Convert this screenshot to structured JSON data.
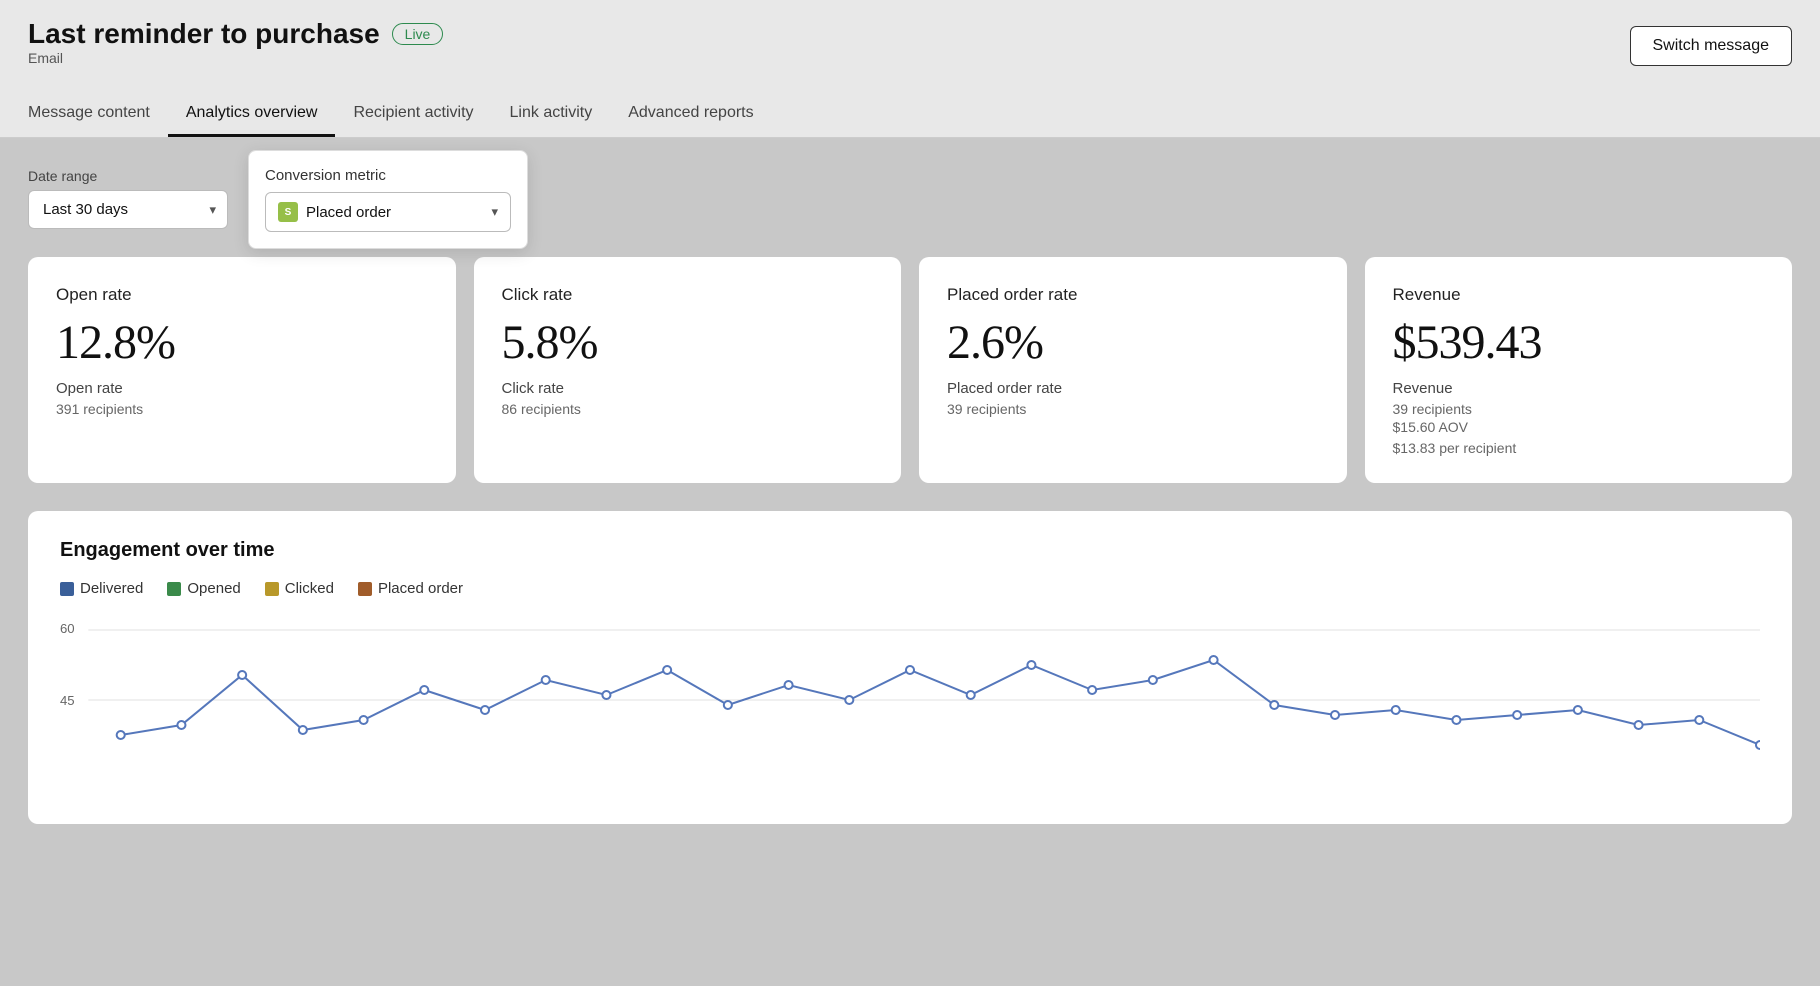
{
  "header": {
    "title": "Last reminder to purchase",
    "badge": "Live",
    "subtitle": "Email",
    "switch_btn": "Switch message"
  },
  "tabs": [
    {
      "id": "message-content",
      "label": "Message content",
      "active": false
    },
    {
      "id": "analytics-overview",
      "label": "Analytics overview",
      "active": true
    },
    {
      "id": "recipient-activity",
      "label": "Recipient activity",
      "active": false
    },
    {
      "id": "link-activity",
      "label": "Link activity",
      "active": false
    },
    {
      "id": "advanced-reports",
      "label": "Advanced reports",
      "active": false
    }
  ],
  "filters": {
    "date_range_label": "Date range",
    "date_range_value": "Last 30 days",
    "conversion_label": "Conversion metric",
    "conversion_value": "Placed order"
  },
  "metrics": [
    {
      "title": "Open rate",
      "value": "12.8%",
      "subtitle": "Open rate",
      "recipients": "391 recipients",
      "extra": ""
    },
    {
      "title": "Click rate",
      "value": "5.8%",
      "subtitle": "Click rate",
      "recipients": "86 recipients",
      "extra": ""
    },
    {
      "title": "Placed order rate",
      "value": "2.6%",
      "subtitle": "Placed order rate",
      "recipients": "39 recipients",
      "extra": ""
    },
    {
      "title": "Revenue",
      "value": "$539.43",
      "subtitle": "Revenue",
      "recipients": "39 recipients",
      "extra": "$15.60 AOV\n$13.83 per recipient"
    }
  ],
  "chart": {
    "title": "Engagement over time",
    "legend": [
      {
        "label": "Delivered",
        "color": "#3a5f99"
      },
      {
        "label": "Opened",
        "color": "#3a8a4a"
      },
      {
        "label": "Clicked",
        "color": "#b8982a"
      },
      {
        "label": "Placed order",
        "color": "#a05c2a"
      }
    ],
    "y_labels": [
      "60",
      "45"
    ],
    "line_color": "#5577bb"
  }
}
